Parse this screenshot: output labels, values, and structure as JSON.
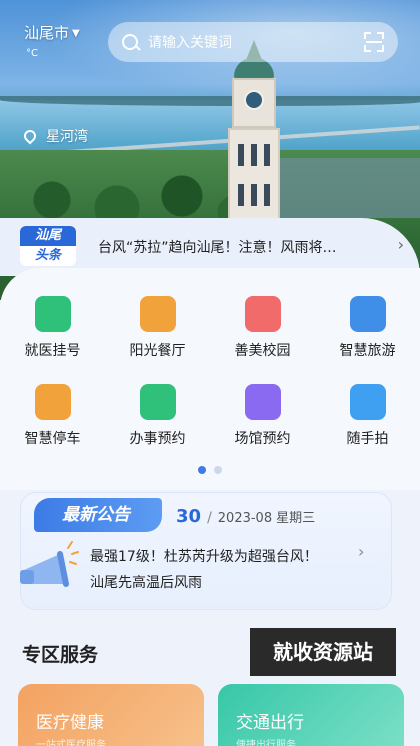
{
  "header": {
    "city": "汕尾市",
    "temperature": "°C",
    "search_placeholder": "请输入关键词",
    "location": "星河湾"
  },
  "headline": {
    "badge_top": "汕尾",
    "badge_bottom": "头条",
    "text": "台风“苏拉”趋向汕尾！注意！风雨将…"
  },
  "services": [
    {
      "label": "就医挂号",
      "icon": "medical-kit-icon",
      "color": "#2fc07a"
    },
    {
      "label": "阳光餐厅",
      "icon": "food-cloche-icon",
      "color": "#f2a23a"
    },
    {
      "label": "善美校园",
      "icon": "school-building-icon",
      "color": "#f26b6b"
    },
    {
      "label": "智慧旅游",
      "icon": "luggage-icon",
      "color": "#3f8fe8"
    },
    {
      "label": "智慧停车",
      "icon": "car-icon",
      "color": "#f2a23a"
    },
    {
      "label": "办事预约",
      "icon": "forward-arrows-icon",
      "color": "#2fc07a"
    },
    {
      "label": "场馆预约",
      "icon": "venue-building-icon",
      "color": "#8a6af0"
    },
    {
      "label": "随手拍",
      "icon": "camera-icon",
      "color": "#3f9ff0"
    }
  ],
  "pager": {
    "pages": 2,
    "active": 0
  },
  "notice": {
    "tag": "最新公告",
    "day": "30",
    "year_month": "2023-08",
    "weekday": "星期三",
    "line1": "最强17级！杜苏芮升级为超强台风！",
    "line2": "汕尾先高温后风雨"
  },
  "section": {
    "title": "专区服务",
    "watermark": "就收资源站",
    "zones": [
      {
        "title": "医疗健康",
        "subtitle": "一站式医疗服务"
      },
      {
        "title": "交通出行",
        "subtitle": "便捷出行服务"
      }
    ]
  }
}
